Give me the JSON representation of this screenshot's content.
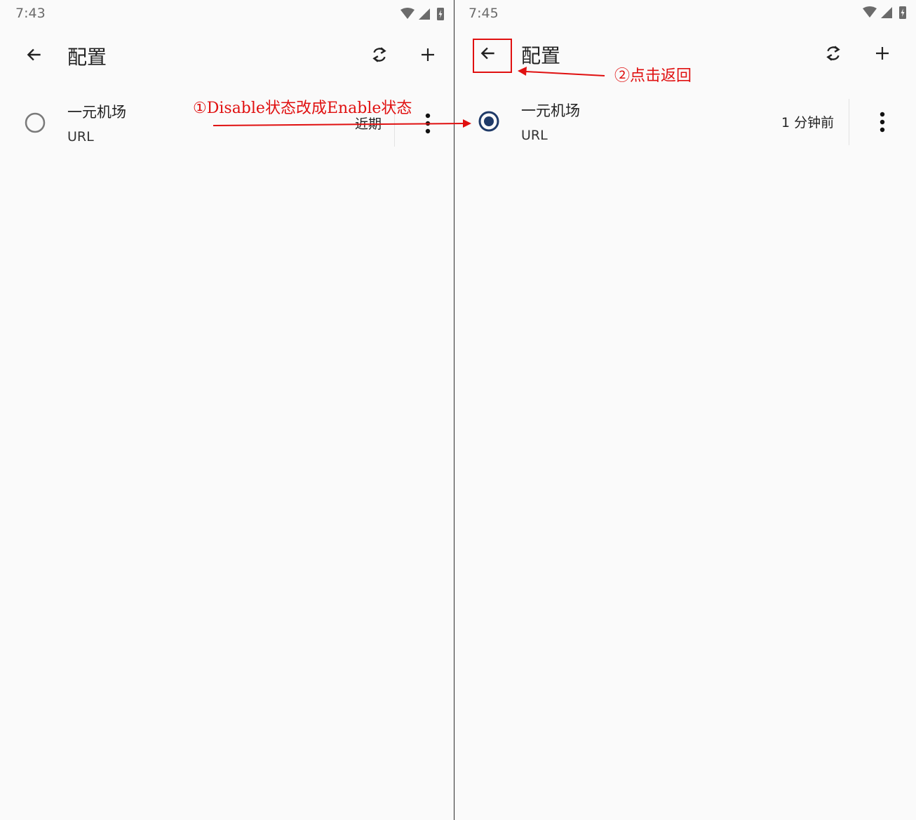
{
  "left_screen": {
    "status": {
      "time": "7:43"
    },
    "toolbar": {
      "title": "配置",
      "icons": [
        "arrow-left-icon",
        "sync-icon",
        "plus-icon"
      ]
    },
    "profile": {
      "name": "一元机场",
      "type": "URL",
      "updated": "近期",
      "selected": false
    }
  },
  "right_screen": {
    "status": {
      "time": "7:45"
    },
    "toolbar": {
      "title": "配置",
      "icons": [
        "arrow-left-icon",
        "sync-icon",
        "plus-icon"
      ]
    },
    "profile": {
      "name": "一元机场",
      "type": "URL",
      "updated": "1 分钟前",
      "selected": true
    }
  },
  "annotations": {
    "step1": "①Disable状态改成Enable状态",
    "step2": "②点击返回"
  },
  "colors": {
    "background": "#fafafa",
    "radio_selected": "#1f3a68",
    "radio_unselected": "#7a7a7a",
    "annotation": "#e01010",
    "text": "#222222"
  }
}
